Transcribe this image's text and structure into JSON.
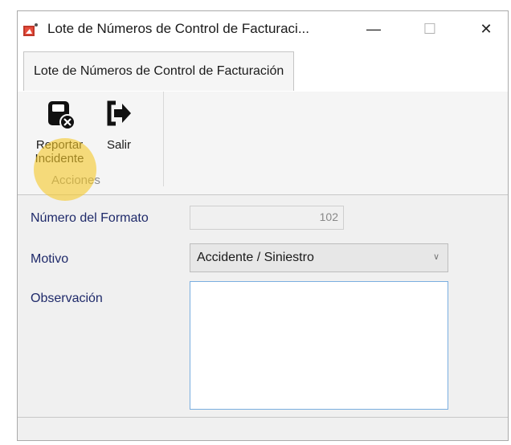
{
  "window": {
    "title": "Lote de Números de Control de Facturaci...",
    "minimize_glyph": "—",
    "maximize_glyph": "☐",
    "close_glyph": "✕",
    "icon": "app-document-icon"
  },
  "tabs": [
    {
      "label": "Lote de Números de Control de Facturación",
      "active": true
    }
  ],
  "ribbon": {
    "group_label": "Acciones",
    "buttons": [
      {
        "line1": "Reportar",
        "line2": "Incidente",
        "icon": "report-incident-icon"
      },
      {
        "line1": "Salir",
        "icon": "exit-icon"
      }
    ]
  },
  "form": {
    "formato": {
      "label": "Número del Formato",
      "value": "102"
    },
    "motivo": {
      "label": "Motivo",
      "value": "Accidente / Siniestro"
    },
    "observacion": {
      "label": "Observación",
      "value": ""
    }
  },
  "colors": {
    "label_text": "#1f2a6a",
    "highlight": "#f5c828",
    "textarea_border": "#7aaee0"
  }
}
